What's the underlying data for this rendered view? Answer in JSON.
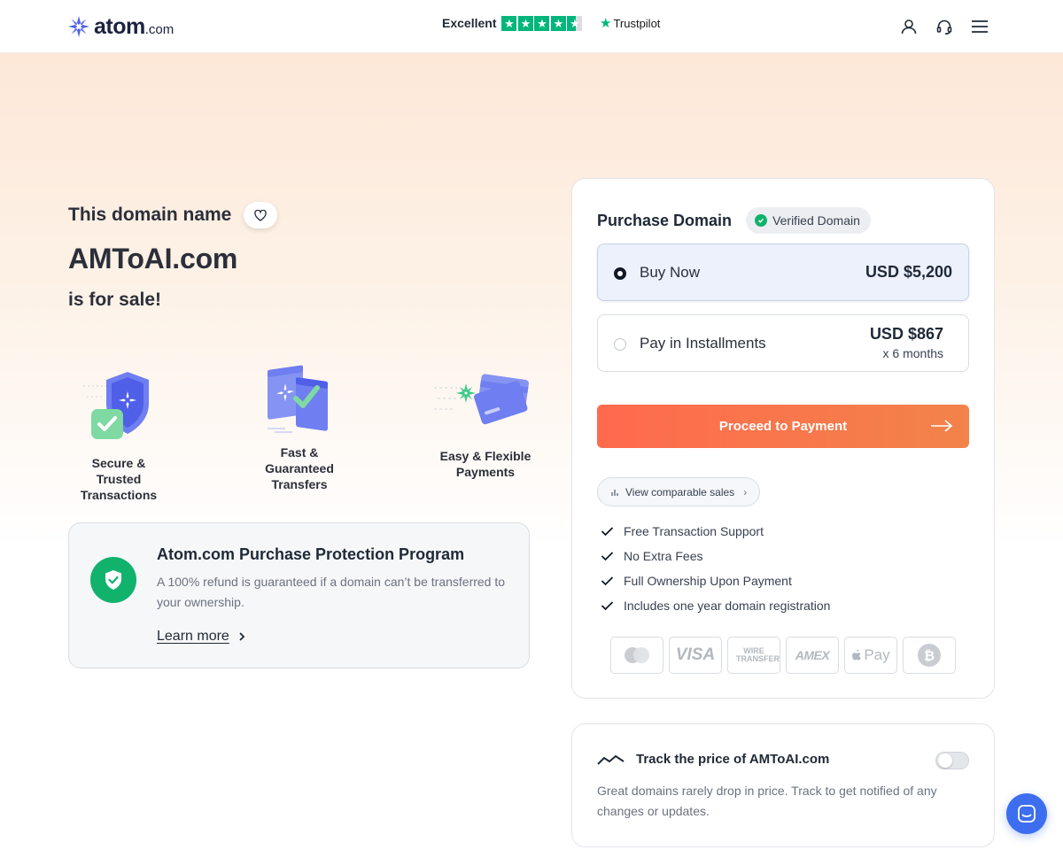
{
  "header": {
    "logo_text": "atom",
    "logo_tld": ".com",
    "trust_label": "Excellent",
    "trust_brand": "Trustpilot",
    "rating_stars": 4.5,
    "icons": [
      "user-icon",
      "headset-icon",
      "menu-icon"
    ]
  },
  "hero": {
    "line1": "This domain name",
    "domain": "AMToAI.com",
    "line3": "is for sale!"
  },
  "features": [
    {
      "label_lines": [
        "Secure & Trusted",
        "Transactions"
      ],
      "icon": "shield-check-icon"
    },
    {
      "label_lines": [
        "Fast &",
        "Guaranteed",
        "Transfers"
      ],
      "icon": "transfer-icon"
    },
    {
      "label_lines": [
        "Easy & Flexible",
        "Payments"
      ],
      "icon": "cards-icon"
    }
  ],
  "protection": {
    "title": "Atom.com Purchase Protection Program",
    "description": "A 100% refund is guaranteed if a domain can’t be transferred to your ownership.",
    "link": "Learn more"
  },
  "purchase": {
    "title": "Purchase Domain",
    "badge": "Verified Domain",
    "options": [
      {
        "label": "Buy Now",
        "price": "USD $5,200",
        "selected": true
      },
      {
        "label": "Pay in Installments",
        "price": "USD $867",
        "sub": "x 6 months",
        "selected": false
      }
    ],
    "cta": "Proceed to Payment",
    "comparable": "View comparable sales",
    "benefits": [
      "Free Transaction Support",
      "No Extra Fees",
      "Full Ownership Upon Payment",
      "Includes one year domain registration"
    ],
    "payment_methods": [
      "Mastercard",
      "VISA",
      "WIRE TRANSFER",
      "AMEX",
      "Pay",
      "Bitcoin"
    ]
  },
  "track": {
    "title": "Track the price of AMToAI.com",
    "description": "Great domains rarely drop in price. Track to get notified of any changes or updates.",
    "enabled": false
  },
  "colors": {
    "accent": "#ff6a4d",
    "success": "#10b26c",
    "trustpilot": "#00b67a",
    "chat": "#3d6ef0"
  }
}
